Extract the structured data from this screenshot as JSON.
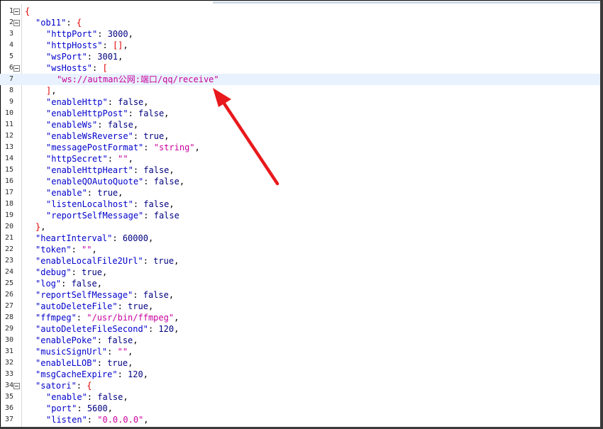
{
  "editor": {
    "lines": [
      {
        "n": "1",
        "fold": true,
        "indent": 0,
        "parts": [
          {
            "t": "br",
            "v": "{"
          }
        ]
      },
      {
        "n": "2",
        "fold": true,
        "indent": 1,
        "parts": [
          {
            "t": "k",
            "v": "\"ob11\""
          },
          {
            "t": "p",
            "v": ": "
          },
          {
            "t": "br",
            "v": "{"
          }
        ]
      },
      {
        "n": "3",
        "indent": 2,
        "parts": [
          {
            "t": "k",
            "v": "\"httpPort\""
          },
          {
            "t": "p",
            "v": ": "
          },
          {
            "t": "n",
            "v": "3000"
          },
          {
            "t": "p",
            "v": ","
          }
        ]
      },
      {
        "n": "4",
        "indent": 2,
        "parts": [
          {
            "t": "k",
            "v": "\"httpHosts\""
          },
          {
            "t": "p",
            "v": ": "
          },
          {
            "t": "br",
            "v": "[]"
          },
          {
            "t": "p",
            "v": ","
          }
        ]
      },
      {
        "n": "5",
        "indent": 2,
        "parts": [
          {
            "t": "k",
            "v": "\"wsPort\""
          },
          {
            "t": "p",
            "v": ": "
          },
          {
            "t": "n",
            "v": "3001"
          },
          {
            "t": "p",
            "v": ","
          }
        ]
      },
      {
        "n": "6",
        "fold": true,
        "indent": 2,
        "parts": [
          {
            "t": "k",
            "v": "\"wsHosts\""
          },
          {
            "t": "p",
            "v": ": "
          },
          {
            "t": "br",
            "v": "["
          }
        ]
      },
      {
        "n": "7",
        "indent": 3,
        "active": true,
        "parts": [
          {
            "t": "s",
            "v": "\"ws://autman公网:端口/qq/receive\""
          }
        ]
      },
      {
        "n": "8",
        "indent": 2,
        "parts": [
          {
            "t": "br",
            "v": "]"
          },
          {
            "t": "p",
            "v": ","
          }
        ]
      },
      {
        "n": "9",
        "indent": 2,
        "parts": [
          {
            "t": "k",
            "v": "\"enableHttp\""
          },
          {
            "t": "p",
            "v": ": "
          },
          {
            "t": "b",
            "v": "false"
          },
          {
            "t": "p",
            "v": ","
          }
        ]
      },
      {
        "n": "10",
        "indent": 2,
        "parts": [
          {
            "t": "k",
            "v": "\"enableHttpPost\""
          },
          {
            "t": "p",
            "v": ": "
          },
          {
            "t": "b",
            "v": "false"
          },
          {
            "t": "p",
            "v": ","
          }
        ]
      },
      {
        "n": "11",
        "indent": 2,
        "parts": [
          {
            "t": "k",
            "v": "\"enableWs\""
          },
          {
            "t": "p",
            "v": ": "
          },
          {
            "t": "b",
            "v": "false"
          },
          {
            "t": "p",
            "v": ","
          }
        ]
      },
      {
        "n": "12",
        "indent": 2,
        "parts": [
          {
            "t": "k",
            "v": "\"enableWsReverse\""
          },
          {
            "t": "p",
            "v": ": "
          },
          {
            "t": "b",
            "v": "true"
          },
          {
            "t": "p",
            "v": ","
          }
        ]
      },
      {
        "n": "13",
        "indent": 2,
        "parts": [
          {
            "t": "k",
            "v": "\"messagePostFormat\""
          },
          {
            "t": "p",
            "v": ": "
          },
          {
            "t": "s",
            "v": "\"string\""
          },
          {
            "t": "p",
            "v": ","
          }
        ]
      },
      {
        "n": "14",
        "indent": 2,
        "parts": [
          {
            "t": "k",
            "v": "\"httpSecret\""
          },
          {
            "t": "p",
            "v": ": "
          },
          {
            "t": "s",
            "v": "\"\""
          },
          {
            "t": "p",
            "v": ","
          }
        ]
      },
      {
        "n": "15",
        "indent": 2,
        "parts": [
          {
            "t": "k",
            "v": "\"enableHttpHeart\""
          },
          {
            "t": "p",
            "v": ": "
          },
          {
            "t": "b",
            "v": "false"
          },
          {
            "t": "p",
            "v": ","
          }
        ]
      },
      {
        "n": "16",
        "indent": 2,
        "parts": [
          {
            "t": "k",
            "v": "\"enableQOAutoQuote\""
          },
          {
            "t": "p",
            "v": ": "
          },
          {
            "t": "b",
            "v": "false"
          },
          {
            "t": "p",
            "v": ","
          }
        ]
      },
      {
        "n": "17",
        "indent": 2,
        "parts": [
          {
            "t": "k",
            "v": "\"enable\""
          },
          {
            "t": "p",
            "v": ": "
          },
          {
            "t": "b",
            "v": "true"
          },
          {
            "t": "p",
            "v": ","
          }
        ]
      },
      {
        "n": "18",
        "indent": 2,
        "parts": [
          {
            "t": "k",
            "v": "\"listenLocalhost\""
          },
          {
            "t": "p",
            "v": ": "
          },
          {
            "t": "b",
            "v": "false"
          },
          {
            "t": "p",
            "v": ","
          }
        ]
      },
      {
        "n": "19",
        "indent": 2,
        "parts": [
          {
            "t": "k",
            "v": "\"reportSelfMessage\""
          },
          {
            "t": "p",
            "v": ": "
          },
          {
            "t": "b",
            "v": "false"
          }
        ]
      },
      {
        "n": "20",
        "indent": 1,
        "parts": [
          {
            "t": "br",
            "v": "}"
          },
          {
            "t": "p",
            "v": ","
          }
        ]
      },
      {
        "n": "21",
        "indent": 1,
        "parts": [
          {
            "t": "k",
            "v": "\"heartInterval\""
          },
          {
            "t": "p",
            "v": ": "
          },
          {
            "t": "n",
            "v": "60000"
          },
          {
            "t": "p",
            "v": ","
          }
        ]
      },
      {
        "n": "22",
        "indent": 1,
        "parts": [
          {
            "t": "k",
            "v": "\"token\""
          },
          {
            "t": "p",
            "v": ": "
          },
          {
            "t": "s",
            "v": "\"\""
          },
          {
            "t": "p",
            "v": ","
          }
        ]
      },
      {
        "n": "23",
        "indent": 1,
        "parts": [
          {
            "t": "k",
            "v": "\"enableLocalFile2Url\""
          },
          {
            "t": "p",
            "v": ": "
          },
          {
            "t": "b",
            "v": "true"
          },
          {
            "t": "p",
            "v": ","
          }
        ]
      },
      {
        "n": "24",
        "indent": 1,
        "parts": [
          {
            "t": "k",
            "v": "\"debug\""
          },
          {
            "t": "p",
            "v": ": "
          },
          {
            "t": "b",
            "v": "true"
          },
          {
            "t": "p",
            "v": ","
          }
        ]
      },
      {
        "n": "25",
        "indent": 1,
        "parts": [
          {
            "t": "k",
            "v": "\"log\""
          },
          {
            "t": "p",
            "v": ": "
          },
          {
            "t": "b",
            "v": "false"
          },
          {
            "t": "p",
            "v": ","
          }
        ]
      },
      {
        "n": "26",
        "indent": 1,
        "parts": [
          {
            "t": "k",
            "v": "\"reportSelfMessage\""
          },
          {
            "t": "p",
            "v": ": "
          },
          {
            "t": "b",
            "v": "false"
          },
          {
            "t": "p",
            "v": ","
          }
        ]
      },
      {
        "n": "27",
        "indent": 1,
        "parts": [
          {
            "t": "k",
            "v": "\"autoDeleteFile\""
          },
          {
            "t": "p",
            "v": ": "
          },
          {
            "t": "b",
            "v": "true"
          },
          {
            "t": "p",
            "v": ","
          }
        ]
      },
      {
        "n": "28",
        "indent": 1,
        "parts": [
          {
            "t": "k",
            "v": "\"ffmpeg\""
          },
          {
            "t": "p",
            "v": ": "
          },
          {
            "t": "s",
            "v": "\"/usr/bin/ffmpeg\""
          },
          {
            "t": "p",
            "v": ","
          }
        ]
      },
      {
        "n": "29",
        "indent": 1,
        "parts": [
          {
            "t": "k",
            "v": "\"autoDeleteFileSecond\""
          },
          {
            "t": "p",
            "v": ": "
          },
          {
            "t": "n",
            "v": "120"
          },
          {
            "t": "p",
            "v": ","
          }
        ]
      },
      {
        "n": "30",
        "indent": 1,
        "parts": [
          {
            "t": "k",
            "v": "\"enablePoke\""
          },
          {
            "t": "p",
            "v": ": "
          },
          {
            "t": "b",
            "v": "false"
          },
          {
            "t": "p",
            "v": ","
          }
        ]
      },
      {
        "n": "31",
        "indent": 1,
        "parts": [
          {
            "t": "k",
            "v": "\"musicSignUrl\""
          },
          {
            "t": "p",
            "v": ": "
          },
          {
            "t": "s",
            "v": "\"\""
          },
          {
            "t": "p",
            "v": ","
          }
        ]
      },
      {
        "n": "32",
        "indent": 1,
        "parts": [
          {
            "t": "k",
            "v": "\"enableLLOB\""
          },
          {
            "t": "p",
            "v": ": "
          },
          {
            "t": "b",
            "v": "true"
          },
          {
            "t": "p",
            "v": ","
          }
        ]
      },
      {
        "n": "33",
        "indent": 1,
        "parts": [
          {
            "t": "k",
            "v": "\"msgCacheExpire\""
          },
          {
            "t": "p",
            "v": ": "
          },
          {
            "t": "n",
            "v": "120"
          },
          {
            "t": "p",
            "v": ","
          }
        ]
      },
      {
        "n": "34",
        "fold": true,
        "indent": 1,
        "parts": [
          {
            "t": "k",
            "v": "\"satori\""
          },
          {
            "t": "p",
            "v": ": "
          },
          {
            "t": "br",
            "v": "{"
          }
        ]
      },
      {
        "n": "35",
        "indent": 2,
        "parts": [
          {
            "t": "k",
            "v": "\"enable\""
          },
          {
            "t": "p",
            "v": ": "
          },
          {
            "t": "b",
            "v": "false"
          },
          {
            "t": "p",
            "v": ","
          }
        ]
      },
      {
        "n": "36",
        "indent": 2,
        "parts": [
          {
            "t": "k",
            "v": "\"port\""
          },
          {
            "t": "p",
            "v": ": "
          },
          {
            "t": "n",
            "v": "5600"
          },
          {
            "t": "p",
            "v": ","
          }
        ]
      },
      {
        "n": "37",
        "indent": 2,
        "parts": [
          {
            "t": "k",
            "v": "\"listen\""
          },
          {
            "t": "p",
            "v": ": "
          },
          {
            "t": "s",
            "v": "\"0.0.0.0\""
          },
          {
            "t": "p",
            "v": ","
          }
        ]
      }
    ]
  },
  "annotation": {
    "arrow_color": "#e8191c"
  },
  "colors": {
    "key": "#0000cc",
    "string": "#c8009c",
    "literal": "#000080",
    "brace": "#e00000",
    "active_line": "#e8f2fe"
  }
}
